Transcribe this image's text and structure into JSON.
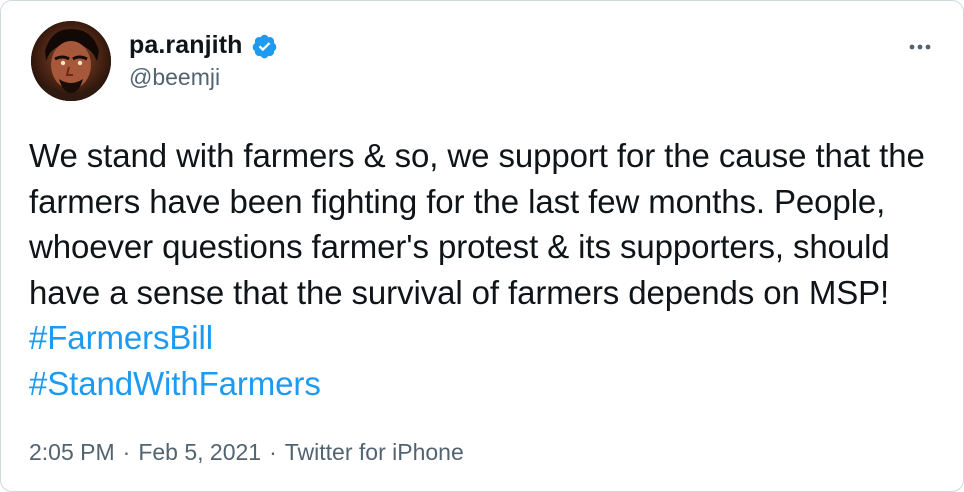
{
  "user": {
    "display_name": "pa.ranjith",
    "handle": "@beemji",
    "verified_icon": "verified-badge-icon",
    "avatar": "avatar"
  },
  "menu": {
    "icon": "more-options-icon"
  },
  "tweet": {
    "text_part1": "We stand with farmers & so, we support for the cause that the farmers have been fighting for the last few months. People, whoever questions farmer's protest & its supporters, should have a sense that the survival of farmers depends on MSP! ",
    "hashtag1": "#FarmersBill",
    "hashtag2": "#StandWithFarmers"
  },
  "meta": {
    "time": "2:05 PM",
    "separator1": "·",
    "date": "Feb 5, 2021",
    "separator2": "·",
    "source": "Twitter for iPhone"
  },
  "colors": {
    "text": "#0f1419",
    "secondary": "#536471",
    "accent": "#1d9bf0"
  }
}
